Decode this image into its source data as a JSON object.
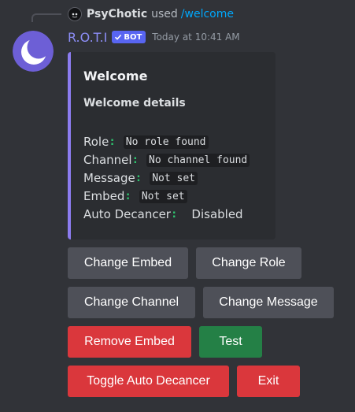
{
  "reply": {
    "user": "PsyChotic",
    "used": "used",
    "command": "/welcome",
    "avatar_icon": "user-avatar-icon"
  },
  "header": {
    "author": "R.O.T.I",
    "bot_tag": "BOT",
    "timestamp": "Today at 10:41 AM",
    "author_color": "#8c8df6"
  },
  "embed": {
    "accent_color": "#8c7cf0",
    "title": "Welcome",
    "subtitle": "Welcome details",
    "fields": [
      {
        "label": "Role",
        "colon": ":",
        "value": "No role found",
        "code": true
      },
      {
        "label": "Channel",
        "colon": ":",
        "value": "No channel found",
        "code": true
      },
      {
        "label": "Message",
        "colon": ":",
        "value": "Not set",
        "code": true
      },
      {
        "label": "Embed",
        "colon": ":",
        "value": "Not set",
        "code": true
      },
      {
        "label": "Auto Decancer",
        "colon": ":",
        "value": "Disabled",
        "code": false
      }
    ]
  },
  "buttons": {
    "change_embed": "Change Embed",
    "change_role": "Change Role",
    "change_channel": "Change Channel",
    "change_message": "Change Message",
    "remove_embed": "Remove Embed",
    "test": "Test",
    "toggle_auto_decancer": "Toggle Auto Decancer",
    "exit": "Exit"
  },
  "colors": {
    "secondary": "#4e5058",
    "danger": "#da373c",
    "success": "#248046",
    "bot_tag": "#5865f2",
    "command_link": "#00a8fc"
  }
}
